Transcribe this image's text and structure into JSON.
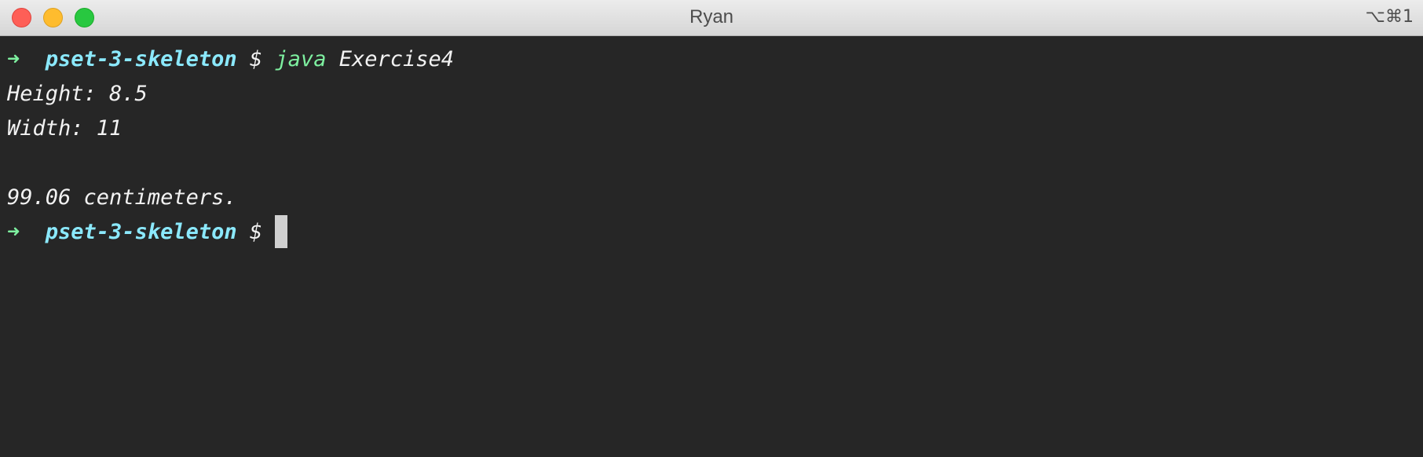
{
  "window": {
    "title": "Ryan",
    "shortcut": "⌥⌘1"
  },
  "terminal": {
    "prompt_arrow": "➜",
    "prompt_dir": "pset-3-skeleton",
    "prompt_symbol": "$",
    "command_program": "java",
    "command_arg": "Exercise4",
    "output_height": "Height: 8.5",
    "output_width": "Width: 11",
    "output_result": "99.06 centimeters."
  }
}
